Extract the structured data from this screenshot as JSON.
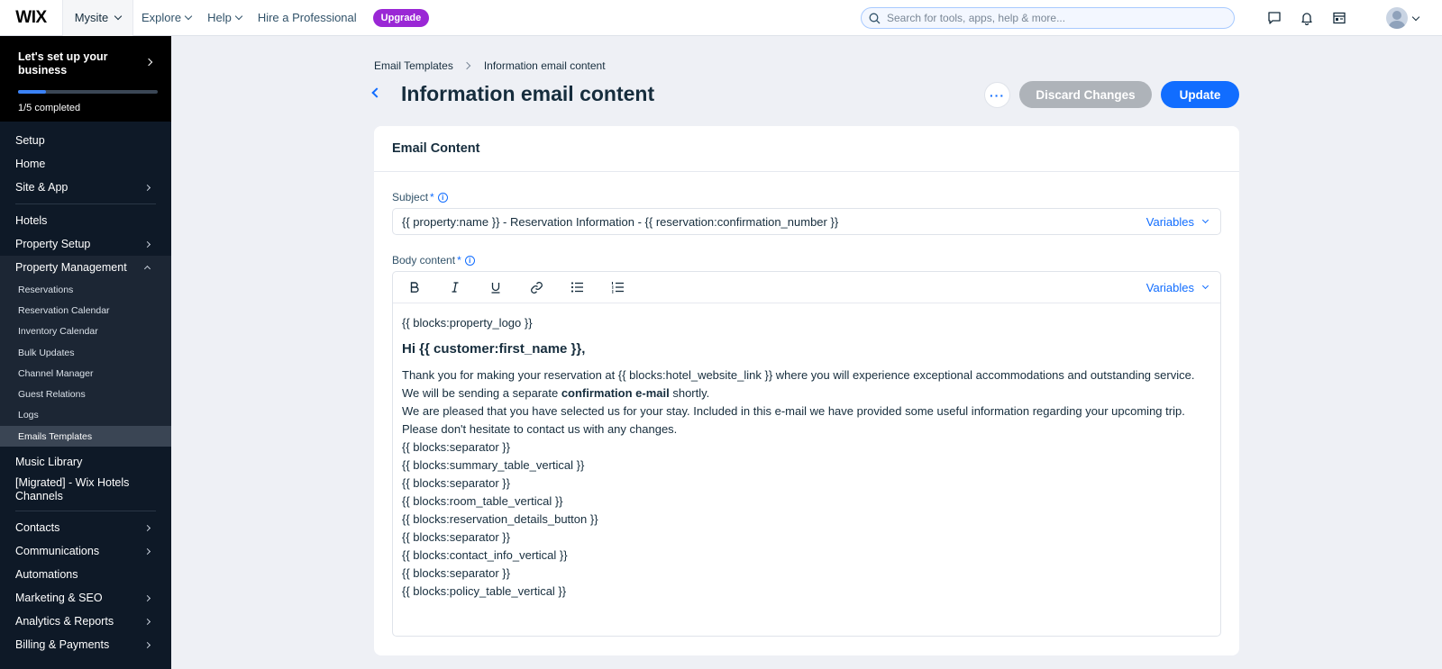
{
  "topbar": {
    "logo": "WIX",
    "site": "Mysite",
    "nav": [
      "Explore",
      "Help"
    ],
    "hire": "Hire a Professional",
    "upgrade": "Upgrade",
    "search_placeholder": "Search for tools, apps, help & more..."
  },
  "sidebar": {
    "setup_title": "Let's set up your business",
    "setup_progress": "1/5 completed",
    "setup_fraction": 0.2,
    "group1": [
      "Setup",
      "Home",
      "Site & App"
    ],
    "group2_top": [
      "Hotels",
      "Property Setup",
      "Property Management"
    ],
    "property_management_items": [
      "Reservations",
      "Reservation Calendar",
      "Inventory Calendar",
      "Bulk Updates",
      "Channel Manager",
      "Guest Relations",
      "Logs",
      "Emails Templates"
    ],
    "group2_bottom": [
      "Music Library",
      "[Migrated] - Wix Hotels Channels"
    ],
    "group3": [
      "Contacts",
      "Communications",
      "Automations",
      "Marketing & SEO",
      "Analytics & Reports",
      "Billing & Payments"
    ]
  },
  "breadcrumb": {
    "parent": "Email Templates",
    "current": "Information email content"
  },
  "page": {
    "title": "Information email content",
    "more": "···",
    "discard": "Discard Changes",
    "update": "Update"
  },
  "card": {
    "header": "Email Content",
    "subject_label": "Subject",
    "required": "*",
    "info": "i",
    "subject_value": "{{ property:name }} - Reservation Information - {{ reservation:confirmation_number }}",
    "variables": "Variables",
    "body_label": "Body content"
  },
  "body": {
    "logo_block": "{{ blocks:property_logo }}",
    "greeting": "Hi {{ customer:first_name }},",
    "p1": "Thank you for making your reservation at {{ blocks:hotel_website_link }} where you will experience exceptional accommodations and outstanding service.",
    "p2_before": "We will be sending a separate ",
    "p2_bold": "confirmation e-mail",
    "p2_after": " shortly.",
    "p3": "We are pleased that you have selected us for your stay. Included in this e-mail we have provided some useful information regarding your upcoming trip. Please don't hesitate to contact us with any changes.",
    "blocks": [
      "{{ blocks:separator }}",
      "{{ blocks:summary_table_vertical }}",
      "{{ blocks:separator }}",
      "{{ blocks:room_table_vertical }}",
      "{{ blocks:reservation_details_button }}",
      "{{ blocks:separator }}",
      "{{ blocks:contact_info_vertical }}",
      "{{ blocks:separator }}",
      "{{ blocks:policy_table_vertical }}"
    ]
  },
  "colors": {
    "accent": "#116dff",
    "upgrade": "#9a27d5",
    "sidebar": "#0e1927",
    "discard": "#aeb3b9"
  }
}
